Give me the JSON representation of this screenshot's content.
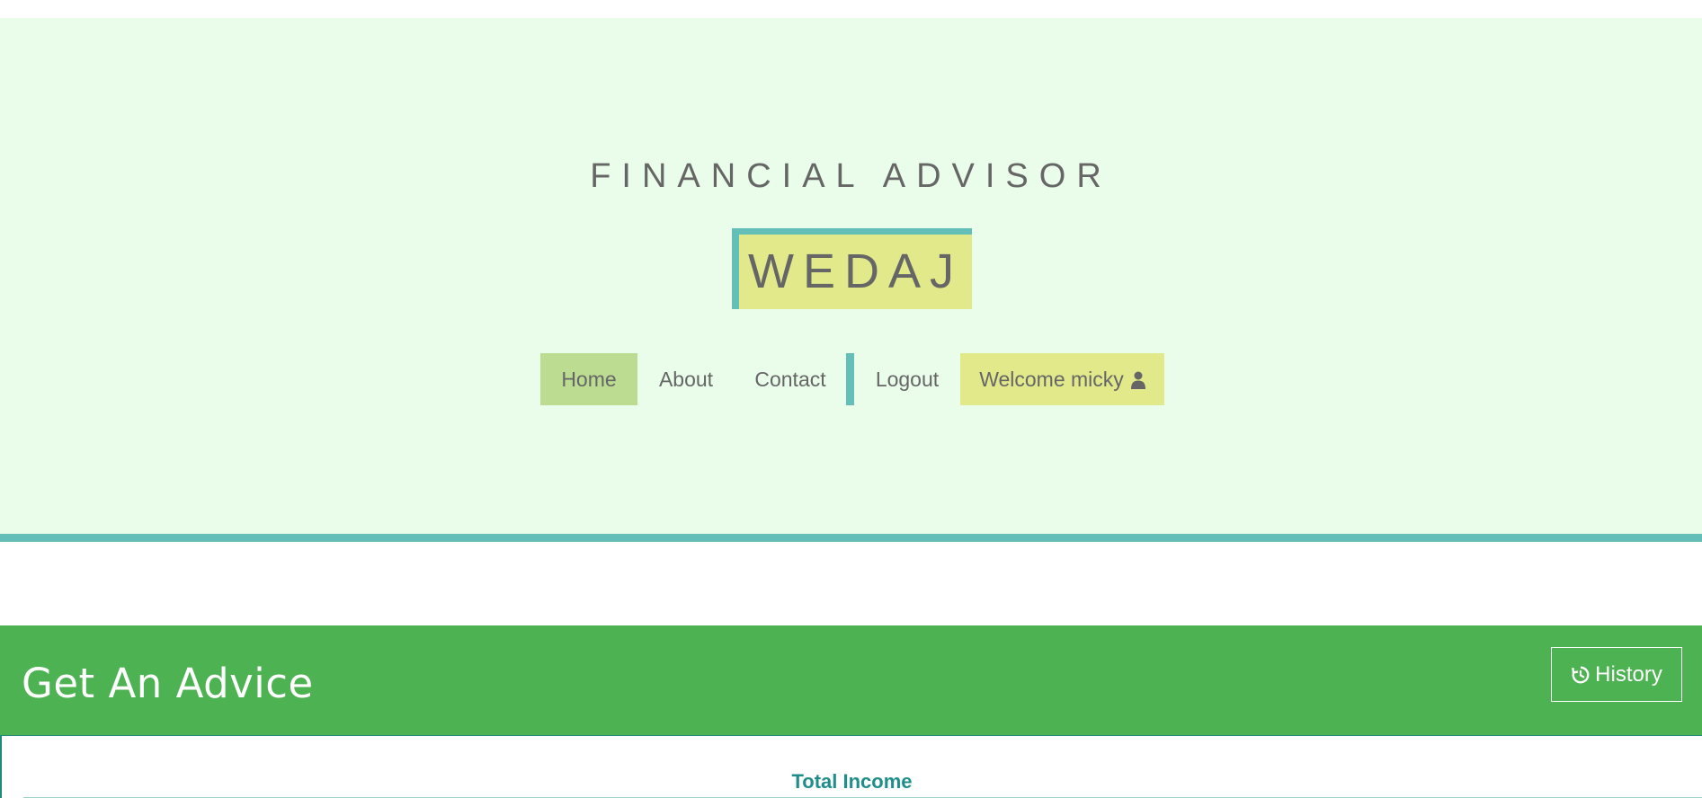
{
  "header": {
    "eyebrow": "FINANCIAL ADVISOR",
    "brand": "WEDAJ"
  },
  "nav": {
    "home": "Home",
    "about": "About",
    "contact": "Contact",
    "logout": "Logout",
    "welcome": "Welcome micky",
    "user_icon": "user-icon"
  },
  "advice": {
    "title": "Get An Advice",
    "history_label": "History",
    "history_icon": "history-icon"
  },
  "form": {
    "total_income_label": "Total Income"
  },
  "colors": {
    "hero_bg": "#eafdea",
    "accent_teal": "#63bfb7",
    "home_active": "#bcdc91",
    "brand_yellow": "#e1e98a",
    "advice_green": "#4db251",
    "label_teal": "#1f8e8a"
  }
}
